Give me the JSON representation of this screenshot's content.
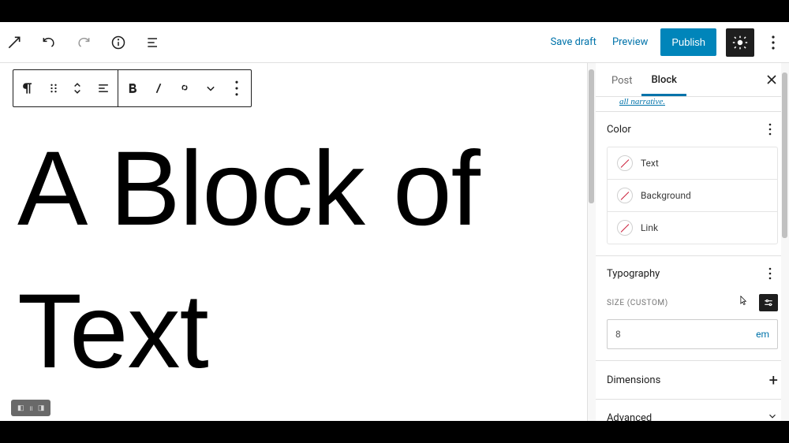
{
  "header": {
    "save_draft": "Save draft",
    "preview": "Preview",
    "publish": "Publish"
  },
  "content": {
    "text": "A Block of Text"
  },
  "sidebar": {
    "tabs": {
      "post": "Post",
      "block": "Block"
    },
    "description_fragment": "all narrative.",
    "color": {
      "heading": "Color",
      "text": "Text",
      "background": "Background",
      "link": "Link"
    },
    "typography": {
      "heading": "Typography",
      "size_label": "Size (custom)",
      "size_value": "8",
      "size_unit": "em"
    },
    "dimensions": {
      "heading": "Dimensions"
    },
    "advanced": {
      "heading": "Advanced"
    }
  }
}
